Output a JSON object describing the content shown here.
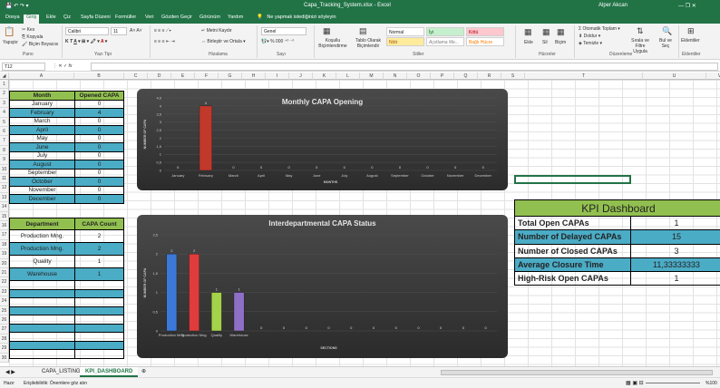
{
  "window": {
    "title": "Capa_Tracking_System.xlsx - Excel",
    "user": "Alper Akcan"
  },
  "tabs": [
    "Dosya",
    "Giriş",
    "Ekle",
    "Çiz",
    "Sayfa Düzeni",
    "Formüller",
    "Veri",
    "Gözden Geçir",
    "Görünüm",
    "Yardım"
  ],
  "tell_me": "Ne yapmak istediğinizi söyleyin",
  "ribbon": {
    "paste": "Yapıştır",
    "cut": "Kes",
    "copy": "Kopyala",
    "format_painter": "Biçim Boyacısı",
    "font_name": "Calibri",
    "font_size": "11",
    "wrap_text": "Metni Kaydır",
    "merge_center": "Birleştir ve Ortala",
    "number_format": "Genel",
    "conditional": "Koşullu Biçimlendirme",
    "format_table": "Tablo Olarak Biçimlendir",
    "styles": {
      "normal": "Normal",
      "iyi": "İyi",
      "kotu": "Kötü",
      "notr": "Nötr",
      "aciklama": "Açıklama Me...",
      "bagli": "Bağlı Hücre"
    },
    "insert": "Ekle",
    "delete": "Sil",
    "format": "Biçim",
    "autosum": "Otomatik Toplam",
    "fill": "Doldur",
    "clear": "Temizle",
    "sort_filter": "Sırala ve Filtre Uygula",
    "find_select": "Bul ve Seç",
    "addins": "Eklentiler",
    "groups": {
      "clipboard": "Pano",
      "font": "Yazı Tipi",
      "alignment": "Hizalama",
      "number": "Sayı",
      "styles": "Stiller",
      "cells": "Hücreler",
      "editing": "Düzenleme",
      "addins": "Eklentiler"
    }
  },
  "formula_bar": {
    "name_box": "T12",
    "fx": "fx"
  },
  "columns": [
    "A",
    "B",
    "C",
    "D",
    "E",
    "F",
    "G",
    "H",
    "I",
    "J",
    "K",
    "L",
    "M",
    "N",
    "O",
    "P",
    "Q",
    "R",
    "S",
    "T",
    "U",
    "V"
  ],
  "rows": [
    "1",
    "2",
    "3",
    "4",
    "5",
    "6",
    "7",
    "8",
    "9",
    "10",
    "11",
    "12",
    "13",
    "14",
    "15",
    "16",
    "17",
    "18",
    "19",
    "20",
    "21",
    "22",
    "23",
    "24",
    "25",
    "26",
    "27",
    "28",
    "29",
    "30"
  ],
  "month_table": {
    "headers": [
      "Month",
      "Opened CAPA"
    ],
    "rows": [
      [
        "January",
        "0"
      ],
      [
        "February",
        "4"
      ],
      [
        "March",
        "0"
      ],
      [
        "April",
        "0"
      ],
      [
        "May",
        "0"
      ],
      [
        "June",
        "0"
      ],
      [
        "July",
        "0"
      ],
      [
        "August",
        "0"
      ],
      [
        "September",
        "0"
      ],
      [
        "October",
        "0"
      ],
      [
        "November",
        "0"
      ],
      [
        "December",
        "0"
      ]
    ]
  },
  "dept_table": {
    "headers": [
      "Department",
      "CAPA Count"
    ],
    "rows": [
      [
        "Production Mng.",
        "2"
      ],
      [
        "Production Mng.",
        "2"
      ],
      [
        "Quality",
        "1"
      ],
      [
        "Warehouse",
        "1"
      ]
    ]
  },
  "chart_data": [
    {
      "type": "bar",
      "title": "Monthly CAPA Opening",
      "xlabel": "MONTHS",
      "ylabel": "NUMBER OF CAPA",
      "categories": [
        "January",
        "February",
        "March",
        "April",
        "May",
        "June",
        "July",
        "August",
        "September",
        "October",
        "November",
        "December"
      ],
      "values": [
        0,
        4,
        0,
        0,
        0,
        0,
        0,
        0,
        0,
        0,
        0,
        0
      ],
      "yticks": [
        "0",
        "0,5",
        "1",
        "1,5",
        "2",
        "2,5",
        "3",
        "3,5",
        "4",
        "4,5"
      ],
      "ylim": [
        0,
        4.5
      ],
      "colors": [
        "#c0392b"
      ]
    },
    {
      "type": "bar",
      "title": "Interdepartmental CAPA Status",
      "xlabel": "SECTIONS",
      "ylabel": "NUMBER OF CAPA",
      "categories": [
        "Production Mng.",
        "Production Mng.",
        "Quality",
        "Warehouse",
        "",
        "",
        "",
        "",
        "",
        "",
        "",
        "",
        "",
        "",
        ""
      ],
      "values": [
        2,
        2,
        1,
        1,
        0,
        0,
        0,
        0,
        0,
        0,
        0,
        0,
        0,
        0,
        0
      ],
      "yticks": [
        "0",
        "0,5",
        "1",
        "1,5",
        "2",
        "2,5"
      ],
      "ylim": [
        0,
        2.5
      ],
      "colors": [
        "#3c78d8",
        "#e03c3c",
        "#a4d34a",
        "#8e6fc6"
      ]
    }
  ],
  "kpi": {
    "title": "KPI Dashboard",
    "rows": [
      [
        "Total Open CAPAs",
        "1"
      ],
      [
        "Number of Delayed CAPAs",
        "15"
      ],
      [
        "Number of Closed CAPAs",
        "3"
      ],
      [
        "Average Closure Time",
        "11,33333333"
      ],
      [
        "High-Risk Open CAPAs",
        "1"
      ]
    ]
  },
  "sheets": [
    "CAPA_LISTING",
    "KPI_DASHBOARD"
  ],
  "status": {
    "mode": "Hazır",
    "accessibility": "Erişilebilirlik: Önemlere göz atın",
    "zoom": "%100"
  }
}
